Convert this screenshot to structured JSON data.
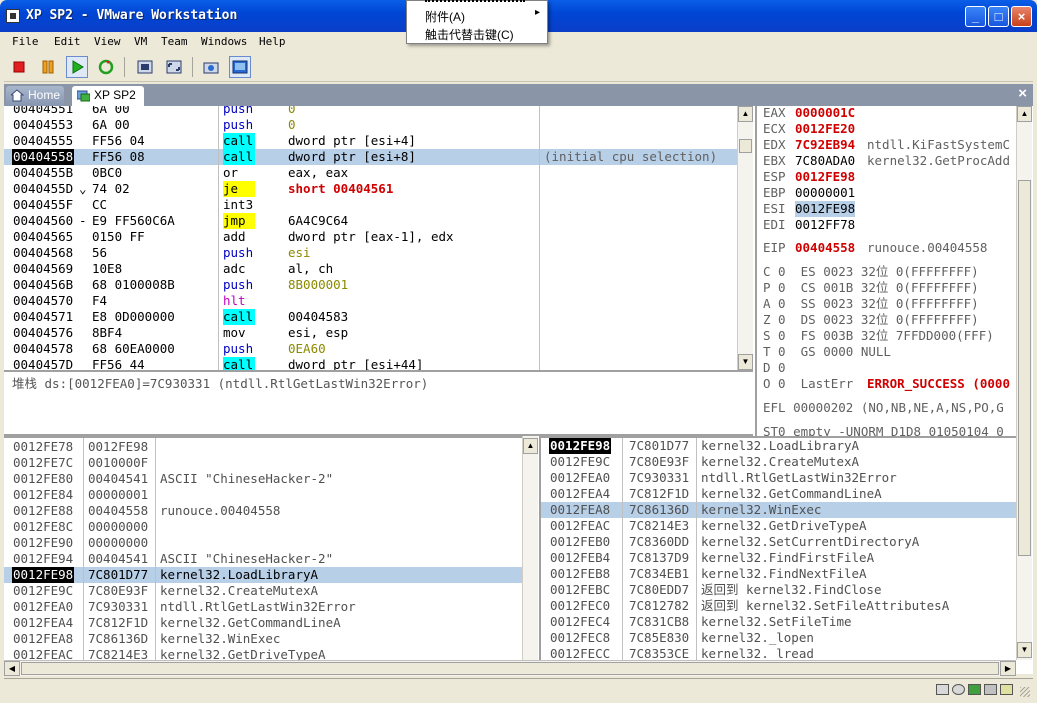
{
  "window": {
    "title": "XP SP2 - VMware Workstation",
    "min": "_",
    "max": "□",
    "close": "×"
  },
  "menu": [
    "File",
    "Edit",
    "View",
    "VM",
    "Team",
    "Windows",
    "Help"
  ],
  "context_menu": {
    "items": [
      {
        "label": "附件(A)",
        "arrow": "▸"
      },
      {
        "label": "触击代替击键(C)"
      }
    ]
  },
  "tabs": {
    "home": "Home",
    "vm": "XP SP2",
    "close": "×"
  },
  "disasm": {
    "rows": [
      {
        "addr": "00404551",
        "hex": "6A 00",
        "mn": "push",
        "ops": "0",
        "cls": "push",
        "mark": ""
      },
      {
        "addr": "00404553",
        "hex": "6A 00",
        "mn": "push",
        "ops": "0",
        "cls": "push",
        "mark": ""
      },
      {
        "addr": "00404555",
        "hex": "FF56 04",
        "mn": "call",
        "ops": "dword ptr [esi+4]",
        "cls": "call",
        "mark": ""
      },
      {
        "addr": "00404558",
        "hex": "FF56 08",
        "mn": "call",
        "ops": "dword ptr [esi+8]",
        "cls": "call",
        "mark": "",
        "comment": "(initial cpu selection)",
        "sel": true
      },
      {
        "addr": "0040455B",
        "hex": "0BC0",
        "mn": "or",
        "ops": "eax, eax",
        "cls": "",
        "mark": ""
      },
      {
        "addr": "0040455D",
        "hex": "74 02",
        "mn": "je",
        "ops": "short 00404561",
        "cls": "jmp",
        "mark": "⌄",
        "redops": true
      },
      {
        "addr": "0040455F",
        "hex": "CC",
        "mn": "int3",
        "ops": "",
        "cls": "",
        "mark": ""
      },
      {
        "addr": "00404560",
        "hex": "E9 FF560C6A",
        "mn": "jmp",
        "ops": "6A4C9C64",
        "cls": "jmp",
        "mark": "-"
      },
      {
        "addr": "00404565",
        "hex": "0150 FF",
        "mn": "add",
        "ops": "dword ptr [eax-1], edx",
        "cls": "",
        "mark": ""
      },
      {
        "addr": "00404568",
        "hex": "56",
        "mn": "push",
        "ops": "esi",
        "cls": "push",
        "mark": ""
      },
      {
        "addr": "00404569",
        "hex": "10E8",
        "mn": "adc",
        "ops": "al, ch",
        "cls": "",
        "mark": ""
      },
      {
        "addr": "0040456B",
        "hex": "68 0100008B",
        "mn": "push",
        "ops": "8B000001",
        "cls": "push",
        "mark": ""
      },
      {
        "addr": "00404570",
        "hex": "F4",
        "mn": "hlt",
        "ops": "",
        "cls": "hlt",
        "mark": ""
      },
      {
        "addr": "00404571",
        "hex": "E8 0D000000",
        "mn": "call",
        "ops": "00404583",
        "cls": "call",
        "mark": ""
      },
      {
        "addr": "00404576",
        "hex": "8BF4",
        "mn": "mov",
        "ops": "esi, esp",
        "cls": "",
        "mark": ""
      },
      {
        "addr": "00404578",
        "hex": "68 60EA0000",
        "mn": "push",
        "ops": "0EA60",
        "cls": "push",
        "mark": ""
      },
      {
        "addr": "0040457D",
        "hex": "FF56 44",
        "mn": "call",
        "ops": "dword ptr [esi+44]",
        "cls": "call",
        "mark": ""
      }
    ],
    "info": "堆栈 ds:[0012FEA0]=7C930331 (ntdll.RtlGetLastWin32Error)"
  },
  "registers": {
    "lines": [
      {
        "name": "EAX",
        "value": "0000001C",
        "changed": true,
        "extra": ""
      },
      {
        "name": "ECX",
        "value": "0012FE20",
        "changed": true,
        "extra": ""
      },
      {
        "name": "EDX",
        "value": "7C92EB94",
        "changed": true,
        "extra": "ntdll.KiFastSystemC"
      },
      {
        "name": "EBX",
        "value": "7C80ADA0",
        "changed": false,
        "extra": "kernel32.GetProcAdd"
      },
      {
        "name": "ESP",
        "value": "0012FE98",
        "changed": true,
        "extra": ""
      },
      {
        "name": "EBP",
        "value": "00000001",
        "changed": false,
        "extra": ""
      },
      {
        "name": "ESI",
        "value": "0012FE98",
        "changed": false,
        "extra": "",
        "sel": true
      },
      {
        "name": "EDI",
        "value": "0012FF78",
        "changed": false,
        "extra": ""
      }
    ],
    "eip": {
      "name": "EIP",
      "value": "00404558",
      "extra": "runouce.00404558"
    },
    "flags": [
      "C 0  ES 0023 32位 0(FFFFFFFF)",
      "P 0  CS 001B 32位 0(FFFFFFFF)",
      "A 0  SS 0023 32位 0(FFFFFFFF)",
      "Z 0  DS 0023 32位 0(FFFFFFFF)",
      "S 0  FS 003B 32位 7FFDD000(FFF)",
      "T 0  GS 0000 NULL",
      "D 0"
    ],
    "lasterr": {
      "prefix": "O 0  LastErr",
      "value": "ERROR_SUCCESS (0000"
    },
    "efl": "EFL 00000202 (NO,NB,NE,A,NS,PO,G",
    "st0": "ST0 empty -UNORM D1D8 01050104 0"
  },
  "dump": {
    "rows": [
      {
        "addr": "0012FE78",
        "val": "0012FE98",
        "desc": ""
      },
      {
        "addr": "0012FE7C",
        "val": "0010000F",
        "desc": ""
      },
      {
        "addr": "0012FE80",
        "val": "00404541",
        "desc": "ASCII \"ChineseHacker-2\""
      },
      {
        "addr": "0012FE84",
        "val": "00000001",
        "desc": ""
      },
      {
        "addr": "0012FE88",
        "val": "00404558",
        "desc": "runouce.00404558"
      },
      {
        "addr": "0012FE8C",
        "val": "00000000",
        "desc": ""
      },
      {
        "addr": "0012FE90",
        "val": "00000000",
        "desc": ""
      },
      {
        "addr": "0012FE94",
        "val": "00404541",
        "desc": "ASCII \"ChineseHacker-2\""
      },
      {
        "addr": "0012FE98",
        "val": "7C801D77",
        "desc": "kernel32.LoadLibraryA",
        "sel": true
      },
      {
        "addr": "0012FE9C",
        "val": "7C80E93F",
        "desc": "kernel32.CreateMutexA"
      },
      {
        "addr": "0012FEA0",
        "val": "7C930331",
        "desc": "ntdll.RtlGetLastWin32Error"
      },
      {
        "addr": "0012FEA4",
        "val": "7C812F1D",
        "desc": "kernel32.GetCommandLineA"
      },
      {
        "addr": "0012FEA8",
        "val": "7C86136D",
        "desc": "kernel32.WinExec"
      },
      {
        "addr": "0012FEAC",
        "val": "7C8214E3",
        "desc": "kernel32.GetDriveTypeA"
      }
    ]
  },
  "stack": {
    "rows": [
      {
        "addr": "0012FE98",
        "val": "7C801D77",
        "desc": "kernel32.LoadLibraryA",
        "hi": true
      },
      {
        "addr": "0012FE9C",
        "val": "7C80E93F",
        "desc": "kernel32.CreateMutexA"
      },
      {
        "addr": "0012FEA0",
        "val": "7C930331",
        "desc": "ntdll.RtlGetLastWin32Error"
      },
      {
        "addr": "0012FEA4",
        "val": "7C812F1D",
        "desc": "kernel32.GetCommandLineA"
      },
      {
        "addr": "0012FEA8",
        "val": "7C86136D",
        "desc": "kernel32.WinExec",
        "sel": true
      },
      {
        "addr": "0012FEAC",
        "val": "7C8214E3",
        "desc": "kernel32.GetDriveTypeA"
      },
      {
        "addr": "0012FEB0",
        "val": "7C8360DD",
        "desc": "kernel32.SetCurrentDirectoryA"
      },
      {
        "addr": "0012FEB4",
        "val": "7C8137D9",
        "desc": "kernel32.FindFirstFileA"
      },
      {
        "addr": "0012FEB8",
        "val": "7C834EB1",
        "desc": "kernel32.FindNextFileA"
      },
      {
        "addr": "0012FEBC",
        "val": "7C80EDD7",
        "desc": "返回到 kernel32.FindClose"
      },
      {
        "addr": "0012FEC0",
        "val": "7C812782",
        "desc": "返回到 kernel32.SetFileAttributesA"
      },
      {
        "addr": "0012FEC4",
        "val": "7C831CB8",
        "desc": "kernel32.SetFileTime"
      },
      {
        "addr": "0012FEC8",
        "val": "7C85E830",
        "desc": "kernel32._lopen"
      },
      {
        "addr": "0012FECC",
        "val": "7C8353CE",
        "desc": "kernel32._lread"
      }
    ]
  },
  "colors": {
    "changed_reg": "#d00000",
    "call_bg": "#00ffff",
    "jmp_bg": "#ffff00",
    "push_fg": "#0000c0",
    "hlt_fg": "#c000c0",
    "selection": "#b8cfe8"
  }
}
